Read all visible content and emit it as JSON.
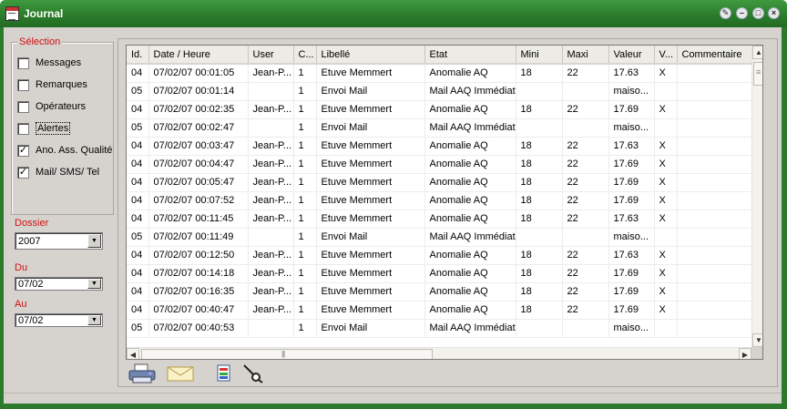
{
  "window": {
    "title": "Journal",
    "controls": [
      "pin",
      "minimize",
      "maximize",
      "close"
    ]
  },
  "selection": {
    "legend": "Sélection",
    "items": [
      {
        "label": "Messages",
        "checked": false
      },
      {
        "label": "Remarques",
        "checked": false
      },
      {
        "label": "Opérateurs",
        "checked": false
      },
      {
        "label": "Alertes",
        "checked": false
      },
      {
        "label": "Ano. Ass. Qualité",
        "checked": true
      },
      {
        "label": "Mail/ SMS/ Tel",
        "checked": true
      }
    ]
  },
  "filters": {
    "dossier_label": "Dossier",
    "dossier_value": "2007",
    "du_label": "Du",
    "du_value": "07/02",
    "au_label": "Au",
    "au_value": "07/02"
  },
  "grid": {
    "columns": [
      "Id.",
      "Date / Heure",
      "User",
      "C...",
      "Libellé",
      "Etat",
      "Mini",
      "Maxi",
      "Valeur",
      "V...",
      "Commentaire"
    ],
    "rows": [
      [
        "04",
        "07/02/07 00:01:05",
        "Jean-P...",
        "1",
        "Etuve Memmert",
        "Anomalie AQ",
        "18",
        "22",
        "17.63",
        "X",
        ""
      ],
      [
        "05",
        "07/02/07 00:01:14",
        "",
        "1",
        "Envoi Mail",
        "Mail AAQ Immédiat",
        "",
        "",
        "maiso...",
        "",
        ""
      ],
      [
        "04",
        "07/02/07 00:02:35",
        "Jean-P...",
        "1",
        "Etuve Memmert",
        "Anomalie AQ",
        "18",
        "22",
        "17.69",
        "X",
        ""
      ],
      [
        "05",
        "07/02/07 00:02:47",
        "",
        "1",
        "Envoi Mail",
        "Mail AAQ Immédiat",
        "",
        "",
        "maiso...",
        "",
        ""
      ],
      [
        "04",
        "07/02/07 00:03:47",
        "Jean-P...",
        "1",
        "Etuve Memmert",
        "Anomalie AQ",
        "18",
        "22",
        "17.63",
        "X",
        ""
      ],
      [
        "04",
        "07/02/07 00:04:47",
        "Jean-P...",
        "1",
        "Etuve Memmert",
        "Anomalie AQ",
        "18",
        "22",
        "17.69",
        "X",
        ""
      ],
      [
        "04",
        "07/02/07 00:05:47",
        "Jean-P...",
        "1",
        "Etuve Memmert",
        "Anomalie AQ",
        "18",
        "22",
        "17.69",
        "X",
        ""
      ],
      [
        "04",
        "07/02/07 00:07:52",
        "Jean-P...",
        "1",
        "Etuve Memmert",
        "Anomalie AQ",
        "18",
        "22",
        "17.69",
        "X",
        ""
      ],
      [
        "04",
        "07/02/07 00:11:45",
        "Jean-P...",
        "1",
        "Etuve Memmert",
        "Anomalie AQ",
        "18",
        "22",
        "17.63",
        "X",
        ""
      ],
      [
        "05",
        "07/02/07 00:11:49",
        "",
        "1",
        "Envoi Mail",
        "Mail AAQ Immédiat",
        "",
        "",
        "maiso...",
        "",
        ""
      ],
      [
        "04",
        "07/02/07 00:12:50",
        "Jean-P...",
        "1",
        "Etuve Memmert",
        "Anomalie AQ",
        "18",
        "22",
        "17.63",
        "X",
        ""
      ],
      [
        "04",
        "07/02/07 00:14:18",
        "Jean-P...",
        "1",
        "Etuve Memmert",
        "Anomalie AQ",
        "18",
        "22",
        "17.69",
        "X",
        ""
      ],
      [
        "04",
        "07/02/07 00:16:35",
        "Jean-P...",
        "1",
        "Etuve Memmert",
        "Anomalie AQ",
        "18",
        "22",
        "17.69",
        "X",
        ""
      ],
      [
        "04",
        "07/02/07 00:40:47",
        "Jean-P...",
        "1",
        "Etuve Memmert",
        "Anomalie AQ",
        "18",
        "22",
        "17.69",
        "X",
        ""
      ],
      [
        "05",
        "07/02/07 00:40:53",
        "",
        "1",
        "Envoi Mail",
        "Mail AAQ Immédiat",
        "",
        "",
        "maiso...",
        "",
        ""
      ]
    ]
  },
  "toolbar": {
    "icons": [
      "printer-icon",
      "mail-icon",
      "export-icon",
      "search-icon"
    ]
  },
  "colors": {
    "titlebar": "#2d7a2d",
    "label_red": "#cc1111",
    "face": "#d6d3ce"
  }
}
